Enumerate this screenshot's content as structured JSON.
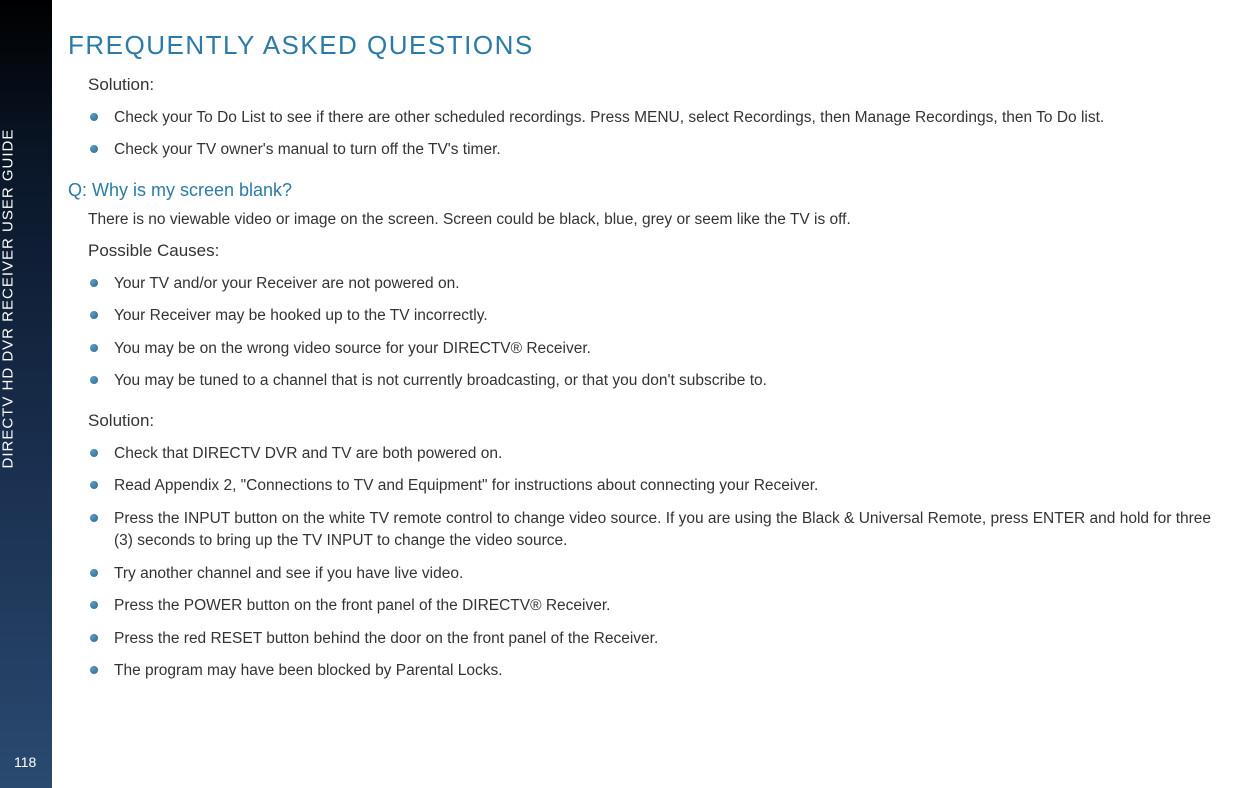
{
  "sidebar": {
    "title": "DIRECTV HD DVR RECEIVER USER GUIDE",
    "pageNumber": "118"
  },
  "pageTitle": "FREQUENTLY ASKED QUESTIONS",
  "section1": {
    "heading": "Solution:",
    "items": [
      "Check your To Do List to see if there are other scheduled recordings. Press MENU, select Recordings, then Manage Recordings, then To Do list.",
      "Check your TV owner's manual to turn off the TV's timer."
    ]
  },
  "question": "Q: Why is my screen blank?",
  "intro": "There is no viewable video or image on the screen. Screen could be black, blue, grey or seem like the TV is off.",
  "possibleCauses": {
    "heading": "Possible Causes:",
    "items": [
      "Your TV and/or your Receiver are not powered on.",
      "Your Receiver may be hooked up to the TV incorrectly.",
      "You may be on the wrong video source for your DIRECTV® Receiver.",
      "You may be tuned to a channel that is not currently broadcasting, or that you don't subscribe to."
    ]
  },
  "solution2": {
    "heading": "Solution:",
    "items": [
      "Check that DIRECTV DVR and TV are both powered on.",
      "Read Appendix 2, \"Connections to TV and Equipment\" for instructions about connecting your Receiver.",
      "Press the INPUT button on the white TV remote control to change video source. If you are using the Black & Universal Remote, press ENTER and hold for three (3) seconds to bring up the TV INPUT to change the video source.",
      "Try another channel and see if you have live video.",
      "Press the POWER button on the front panel of the DIRECTV® Receiver.",
      "Press the red RESET button behind the door on the front panel of the Receiver.",
      "The program may have been blocked by Parental Locks."
    ]
  }
}
